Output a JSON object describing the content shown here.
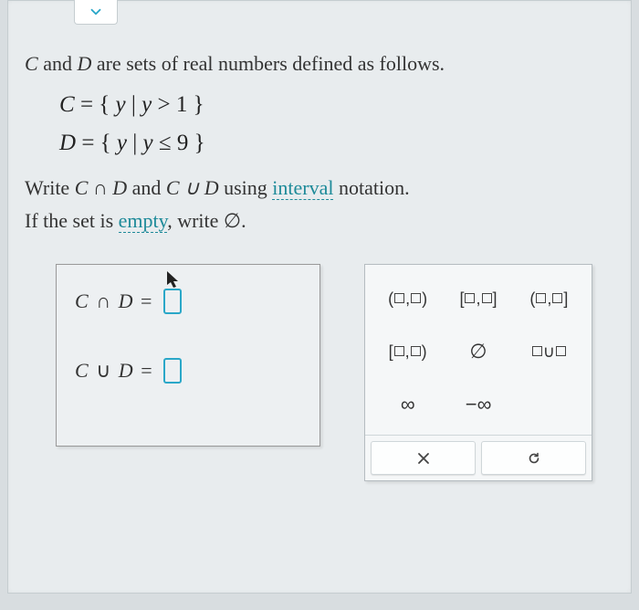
{
  "problem": {
    "intro_prefix": "C",
    "intro_mid": " and ",
    "intro_set2": "D",
    "intro_suffix": " are sets of real numbers defined as follows.",
    "def_C": "C = { y | y > 1 }",
    "def_D": "D = { y | y ≤ 9 }",
    "task_prefix": "Write ",
    "task_expr1": "C ∩ D",
    "task_mid": " and ",
    "task_expr2": "C ∪ D",
    "task_suffix": " using ",
    "task_link": "interval",
    "task_end": " notation.",
    "hint_prefix": "If the set is ",
    "hint_link": "empty",
    "hint_suffix": ", write ∅."
  },
  "answers": {
    "row1_label": "C ∩ D =",
    "row2_label": "C ∪ D ="
  },
  "palette": {
    "open_open": "(□,□)",
    "closed_closed": "[□,□]",
    "open_closed": "(□,□]",
    "closed_open": "[□,□)",
    "empty": "∅",
    "union": "□∪□",
    "inf": "∞",
    "neg_inf": "−∞"
  },
  "actions": {
    "clear": "×",
    "reset": "↺"
  }
}
